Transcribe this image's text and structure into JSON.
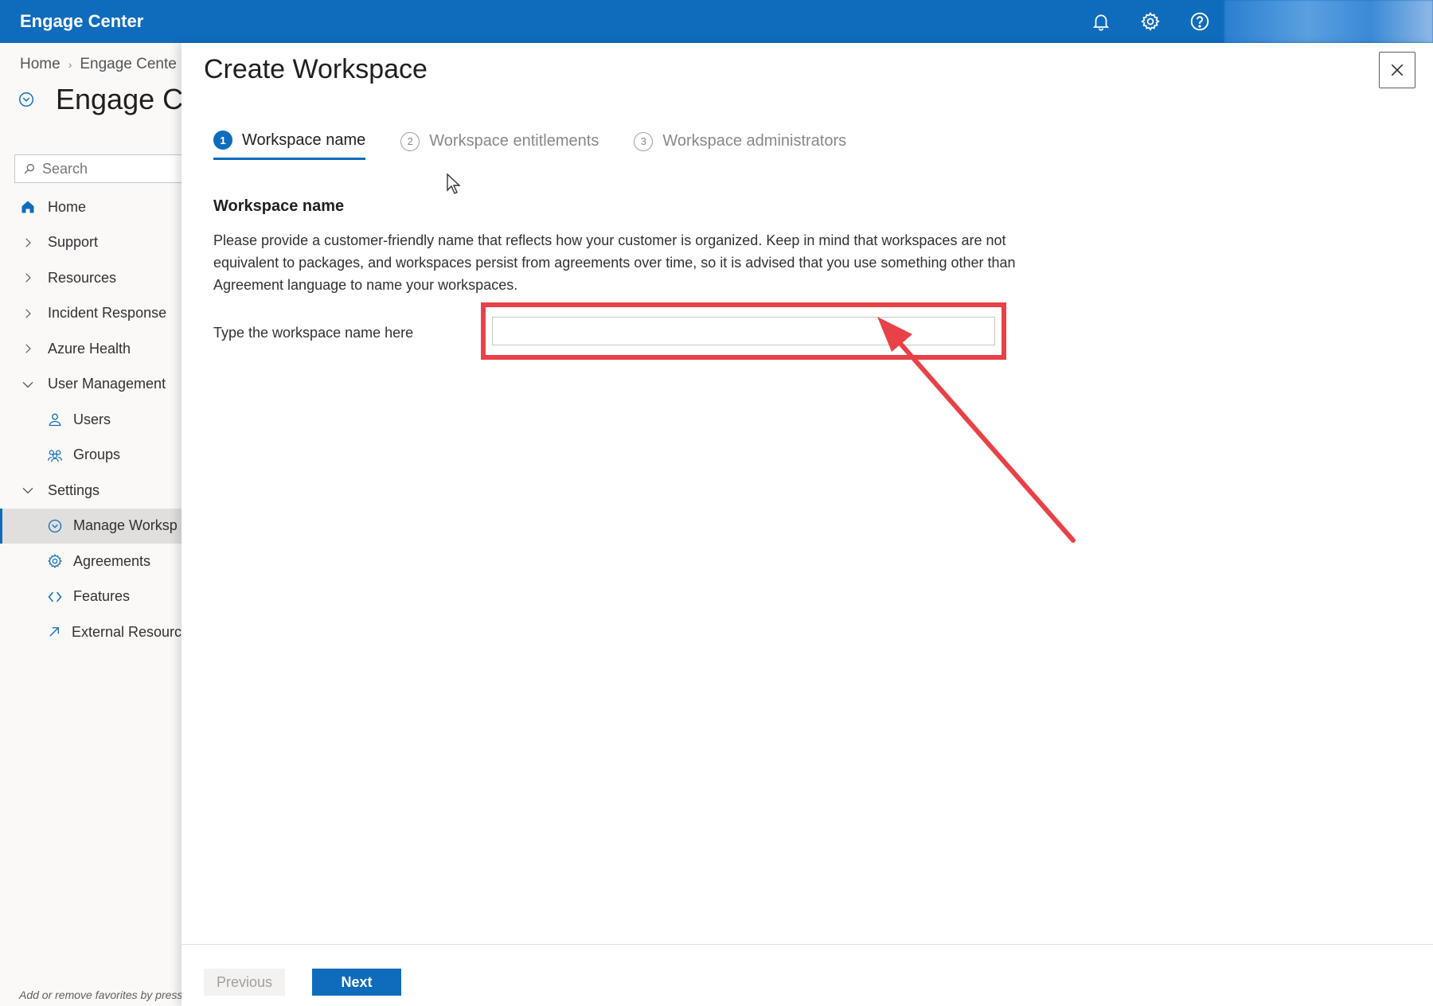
{
  "app": {
    "title": "Engage Center"
  },
  "topbar": {
    "icons": [
      "bell-icon",
      "gear-icon",
      "help-icon"
    ]
  },
  "background_page": {
    "breadcrumb": [
      "Home",
      "Engage Cente"
    ],
    "title": "Engage Ce",
    "search_placeholder": "Search",
    "nav": [
      {
        "label": "Home",
        "icon": "home-icon",
        "level": 0
      },
      {
        "label": "Support",
        "icon": "chevron-right-icon",
        "level": 0
      },
      {
        "label": "Resources",
        "icon": "chevron-right-icon",
        "level": 0
      },
      {
        "label": "Incident Response",
        "icon": "chevron-right-icon",
        "level": 0
      },
      {
        "label": "Azure Health",
        "icon": "chevron-right-icon",
        "level": 0
      },
      {
        "label": "User Management",
        "icon": "chevron-down-icon",
        "level": 0
      },
      {
        "label": "Users",
        "icon": "user-icon",
        "level": 1
      },
      {
        "label": "Groups",
        "icon": "group-icon",
        "level": 1
      },
      {
        "label": "Settings",
        "icon": "chevron-down-icon",
        "level": 0
      },
      {
        "label": "Manage Worksp",
        "icon": "workspace-icon",
        "level": 1,
        "selected": true
      },
      {
        "label": "Agreements",
        "icon": "gear-icon",
        "level": 1
      },
      {
        "label": "Features",
        "icon": "features-icon",
        "level": 1
      },
      {
        "label": "External Resourc",
        "icon": "external-link-icon",
        "level": 1
      }
    ],
    "favorites_note": "Add or remove favorites by pressi"
  },
  "blade": {
    "title": "Create Workspace",
    "steps": [
      {
        "num": "1",
        "label": "Workspace name",
        "active": true
      },
      {
        "num": "2",
        "label": "Workspace entitlements",
        "active": false
      },
      {
        "num": "3",
        "label": "Workspace administrators",
        "active": false
      }
    ],
    "section_heading": "Workspace name",
    "description": "Please provide a customer-friendly name that reflects how your customer is organized. Keep in mind that workspaces are not equivalent to packages, and workspaces persist from agreements over time, so it is advised that you use something other than Agreement language to name your workspaces.",
    "field_label": "Type the workspace name here",
    "field_value": "",
    "buttons": {
      "previous": "Previous",
      "next": "Next"
    }
  },
  "colors": {
    "brand": "#0f6cbd",
    "annotation": "#e84147"
  }
}
